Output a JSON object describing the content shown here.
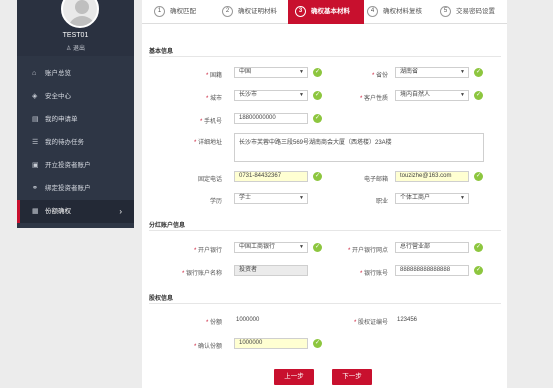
{
  "sidebar": {
    "username": "TEST01",
    "logout": "退出",
    "items": [
      {
        "label": "账户总览",
        "icon": "home-icon"
      },
      {
        "label": "安全中心",
        "icon": "shield-icon"
      },
      {
        "label": "我的申请单",
        "icon": "document-icon"
      },
      {
        "label": "我的待办任务",
        "icon": "task-icon"
      },
      {
        "label": "开立投资者账户",
        "icon": "account-icon"
      },
      {
        "label": "绑定投资者账户",
        "icon": "link-icon"
      },
      {
        "label": "份额确权",
        "icon": "share-icon"
      }
    ]
  },
  "steps": [
    {
      "num": "1",
      "label": "确权匹配"
    },
    {
      "num": "2",
      "label": "确权证明材料"
    },
    {
      "num": "3",
      "label": "确权基本材料"
    },
    {
      "num": "4",
      "label": "确权材料复核"
    },
    {
      "num": "5",
      "label": "交易密码设置"
    }
  ],
  "sections": {
    "basic": "基本信息",
    "dividend": "分红账户信息",
    "shares": "股权信息"
  },
  "form": {
    "country_label": "国籍",
    "country_value": "中国",
    "province_label": "省份",
    "province_value": "湖南省",
    "city_label": "城市",
    "city_value": "长沙市",
    "customer_type_label": "客户性质",
    "customer_type_value": "境内自然人",
    "phone_label": "手机号",
    "phone_value": "18800000000",
    "address_label": "详细地址",
    "address_value": "长沙市芙蓉中路三段569号湖南商会大厦（西塔楼）23A楼",
    "tel_label": "固定电话",
    "tel_value": "0731-84432367",
    "email_label": "电子邮箱",
    "email_value": "touzizhe@163.com",
    "edu_label": "学历",
    "edu_value": "学士",
    "job_label": "职业",
    "job_value": "个体工商户"
  },
  "dividend": {
    "bank_label": "开户银行",
    "bank_value": "中国工商银行",
    "branch_label": "开户银行网点",
    "branch_value": "总行营业部",
    "acct_name_label": "银行账户名称",
    "acct_name_value": "投资者",
    "acct_no_label": "银行账号",
    "acct_no_value": "888888888888888"
  },
  "shares": {
    "shares_label": "份额",
    "shares_value": "1000000",
    "cert_label": "股权证编号",
    "cert_value": "123456",
    "confirm_label": "确认份额",
    "confirm_value": "1000000"
  },
  "buttons": {
    "prev": "上一步",
    "next": "下一步"
  }
}
